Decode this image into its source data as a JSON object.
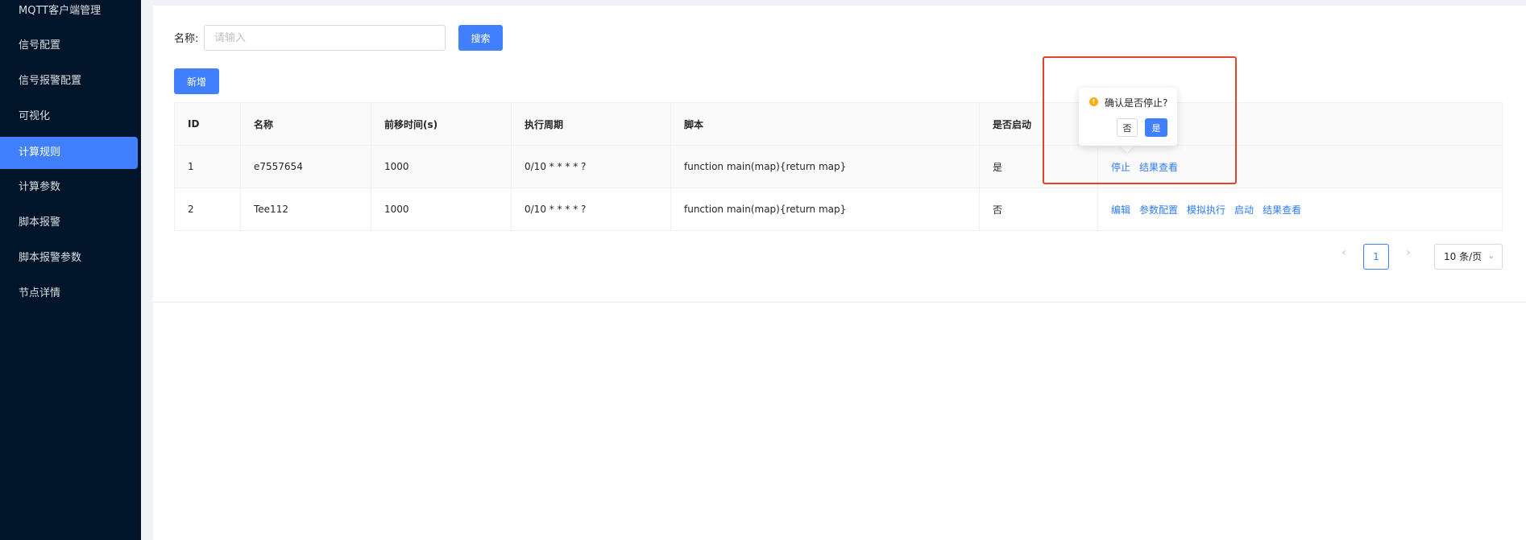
{
  "sidebar": {
    "items": [
      {
        "label": "MQTT客户端管理"
      },
      {
        "label": "信号配置"
      },
      {
        "label": "信号报警配置"
      },
      {
        "label": "可视化"
      },
      {
        "label": "计算规则"
      },
      {
        "label": "计算参数"
      },
      {
        "label": "脚本报警"
      },
      {
        "label": "脚本报警参数"
      },
      {
        "label": "节点详情"
      }
    ],
    "active": "计算规则"
  },
  "search": {
    "label": "名称:",
    "placeholder": "请输入",
    "value": "",
    "button": "搜索"
  },
  "toolbar": {
    "add_label": "新增"
  },
  "table": {
    "columns": [
      "ID",
      "名称",
      "前移时间(s)",
      "执行周期",
      "脚本",
      "是否启动",
      ""
    ],
    "rows": [
      {
        "id": "1",
        "name": "e7557654",
        "offset": "1000",
        "cycle": "0/10 * * * * ?",
        "script": "function main(map){return map}",
        "enabled": "是",
        "actions": [
          "停止",
          "结果查看"
        ]
      },
      {
        "id": "2",
        "name": "Tee112",
        "offset": "1000",
        "cycle": "0/10 * * * * ?",
        "script": "function main(map){return map}",
        "enabled": "否",
        "actions": [
          "编辑",
          "参数配置",
          "模拟执行",
          "启动",
          "结果查看"
        ]
      }
    ]
  },
  "pagination": {
    "prev": "‹",
    "current": "1",
    "next": "›",
    "page_size": "10 条/页"
  },
  "popconfirm": {
    "icon": "!",
    "message": "确认是否停止?",
    "cancel": "否",
    "confirm": "是"
  },
  "colors": {
    "sidebar_bg": "#001529",
    "primary": "#4080ff",
    "link": "#2f7cf6",
    "warning": "#faad14",
    "highlight": "#e0442e"
  }
}
